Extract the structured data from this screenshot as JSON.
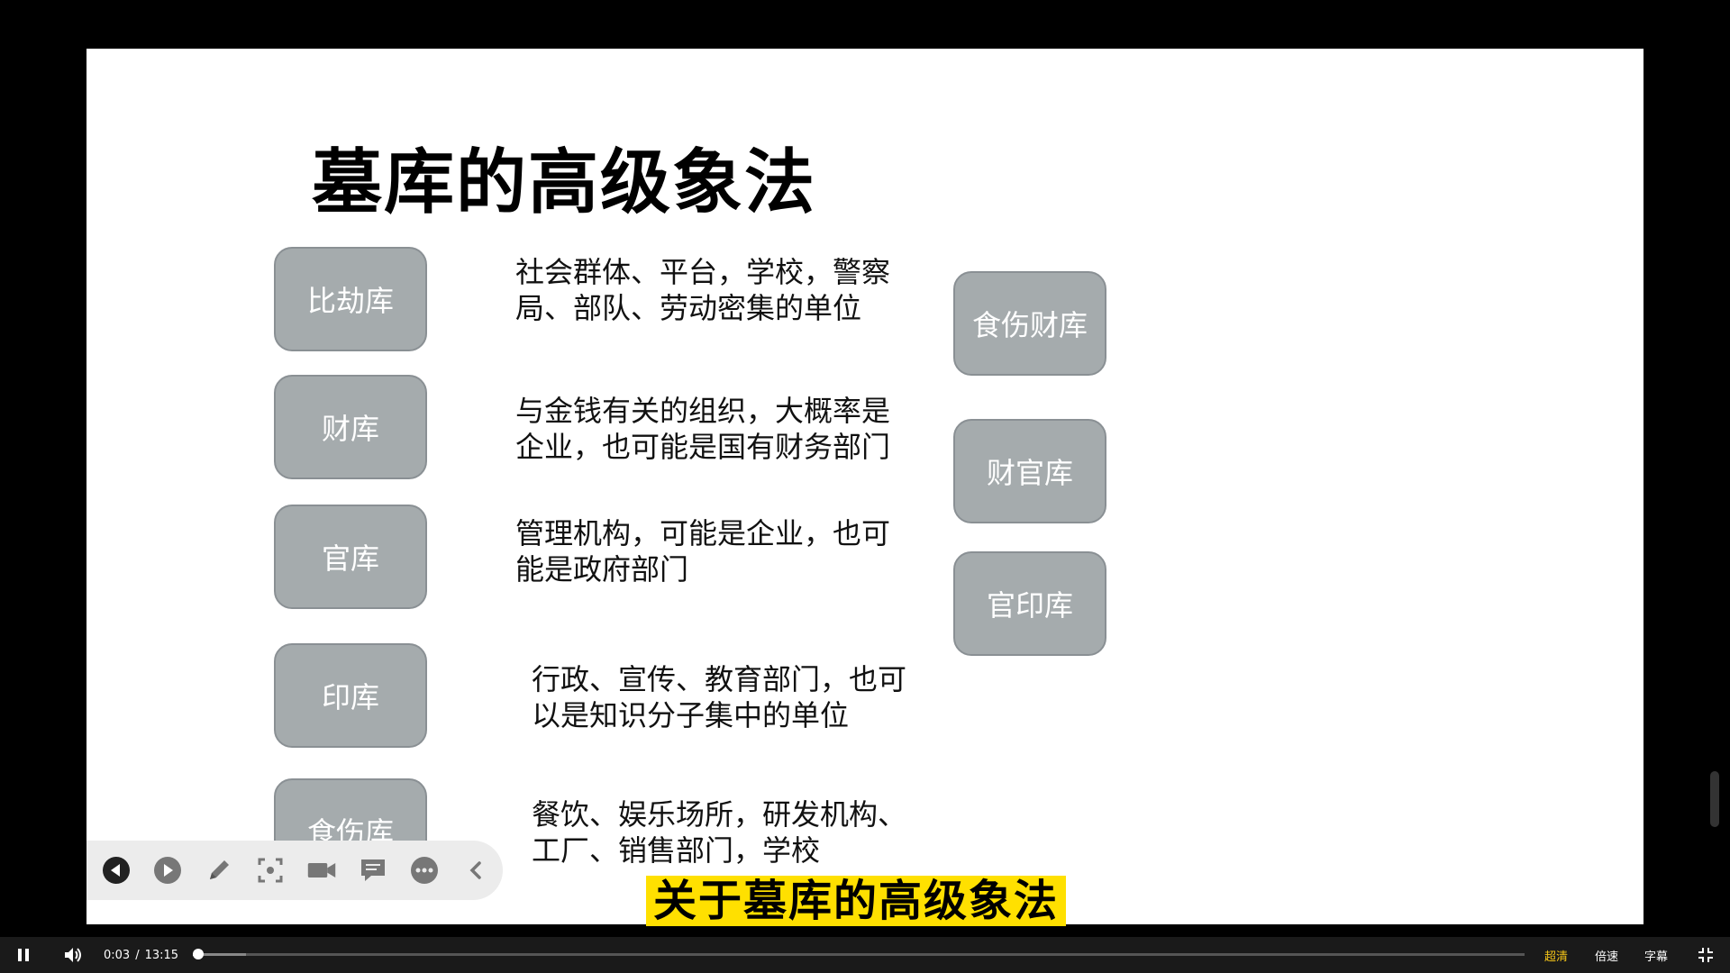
{
  "slide": {
    "title": "墓库的高级象法",
    "left_boxes": [
      "比劫库",
      "财库",
      "官库",
      "印库",
      "食伤库"
    ],
    "descriptions": [
      [
        "社会群体、平台，学校，警察",
        "局、部队、劳动密集的单位"
      ],
      [
        "与金钱有关的组织，大概率是",
        "企业，也可能是国有财务部门"
      ],
      [
        "管理机构，可能是企业，也可",
        "能是政府部门"
      ],
      [
        "行政、宣传、教育部门，也可",
        "以是知识分子集中的单位"
      ],
      [
        "餐饮、娱乐场所，研发机构、",
        "工厂、销售部门，学校"
      ]
    ],
    "right_boxes": [
      "食伤财库",
      "财官库",
      "官印库"
    ]
  },
  "subtitle": "关于墓库的高级象法",
  "toolbar": {
    "icons": [
      "previous-icon",
      "next-icon",
      "pen-icon",
      "screenshot-icon",
      "camera-icon",
      "comment-icon",
      "more-icon",
      "collapse-icon"
    ]
  },
  "player": {
    "current_time": "0:03",
    "separator": "/",
    "duration": "13:15",
    "played_fraction": 0.004,
    "buffered_fraction": 0.04,
    "quality_label": "超清",
    "speed_label": "倍速",
    "subtitle_label": "字幕",
    "accent_color": "#f5c518"
  }
}
